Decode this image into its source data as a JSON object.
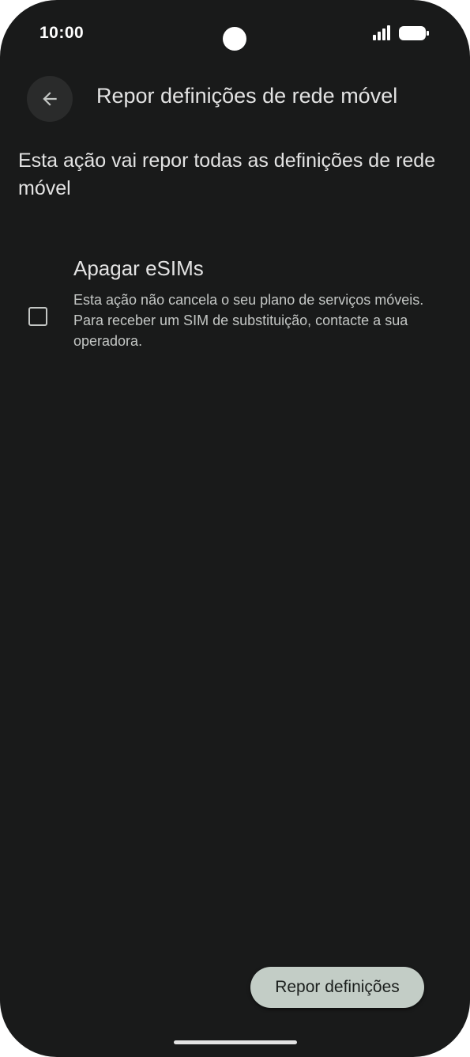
{
  "status_bar": {
    "time": "10:00"
  },
  "app_bar": {
    "back_icon": "arrow-back-icon",
    "title": "Repor definições de rede móvel"
  },
  "description": "Esta ação vai repor todas as definições de rede móvel",
  "option": {
    "checked": false,
    "title": "Apagar eSIMs",
    "summary": "Esta ação não cancela o seu plano de serviços móveis. Para receber um SIM de substituição, contacte a sua operadora."
  },
  "reset_button": {
    "label": "Repor definições"
  },
  "colors": {
    "background": "#191a1a",
    "button_background": "#c3cdc6",
    "text_primary": "#e3e3e3",
    "text_secondary": "#c4c7c5"
  }
}
